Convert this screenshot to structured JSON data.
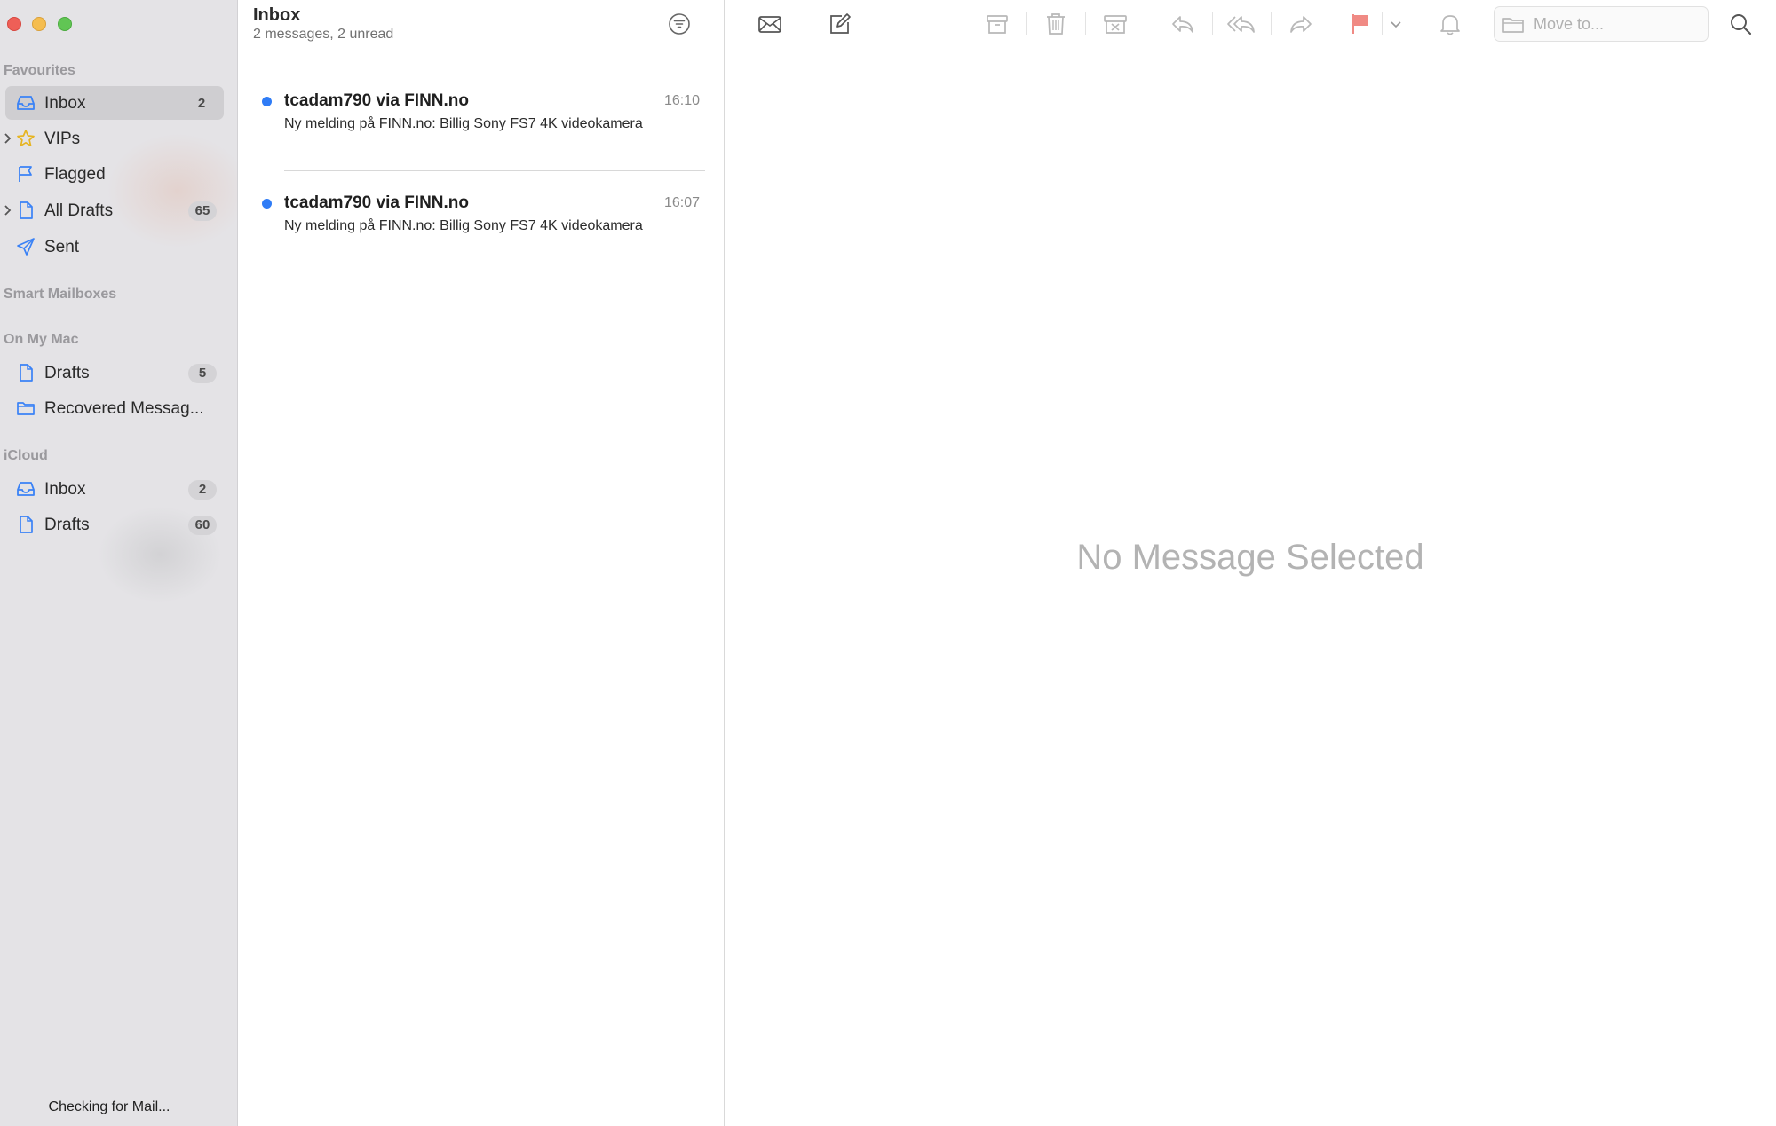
{
  "sidebar": {
    "sections": [
      {
        "title": "Favourites",
        "items": [
          {
            "label": "Inbox",
            "icon": "inbox-icon",
            "count": "2"
          },
          {
            "label": "VIPs",
            "icon": "star-icon"
          },
          {
            "label": "Flagged",
            "icon": "flag-icon"
          },
          {
            "label": "All Drafts",
            "icon": "document-icon",
            "count": "65"
          },
          {
            "label": "Sent",
            "icon": "paper-plane-icon"
          }
        ]
      },
      {
        "title": "Smart Mailboxes",
        "items": []
      },
      {
        "title": "On My Mac",
        "items": [
          {
            "label": "Drafts",
            "icon": "document-icon",
            "count": "5"
          },
          {
            "label": "Recovered Messag...",
            "icon": "folder-icon"
          }
        ]
      },
      {
        "title": "iCloud",
        "items": [
          {
            "label": "Inbox",
            "icon": "inbox-icon",
            "count": "2"
          },
          {
            "label": "Drafts",
            "icon": "document-icon",
            "count": "60"
          }
        ]
      }
    ],
    "status": "Checking for Mail..."
  },
  "list": {
    "title": "Inbox",
    "subtitle": "2 messages, 2 unread",
    "messages": [
      {
        "sender": "tcadam790 via FINN.no",
        "time": "16:10",
        "subject": "Ny melding på FINN.no: Billig Sony FS7 4K videokamera",
        "unread": true
      },
      {
        "sender": "tcadam790 via FINN.no",
        "time": "16:07",
        "subject": "Ny melding på FINN.no: Billig Sony FS7 4K videokamera",
        "unread": true
      }
    ]
  },
  "toolbar": {
    "buttons": [
      "get-mail-icon",
      "compose-icon",
      "archive-icon",
      "trash-icon",
      "junk-icon",
      "reply-icon",
      "reply-all-icon",
      "forward-icon",
      "flag-icon",
      "chevron-down-icon",
      "bell-icon",
      "search-icon"
    ],
    "move_to_placeholder": "Move to..."
  },
  "reading_pane": {
    "empty_text": "No Message Selected"
  },
  "colors": {
    "accent": "#2f7cf6",
    "sidebar_bg": "#e4e3e6",
    "flag": "#f08a84",
    "icon_blue": "#3a82f6"
  }
}
